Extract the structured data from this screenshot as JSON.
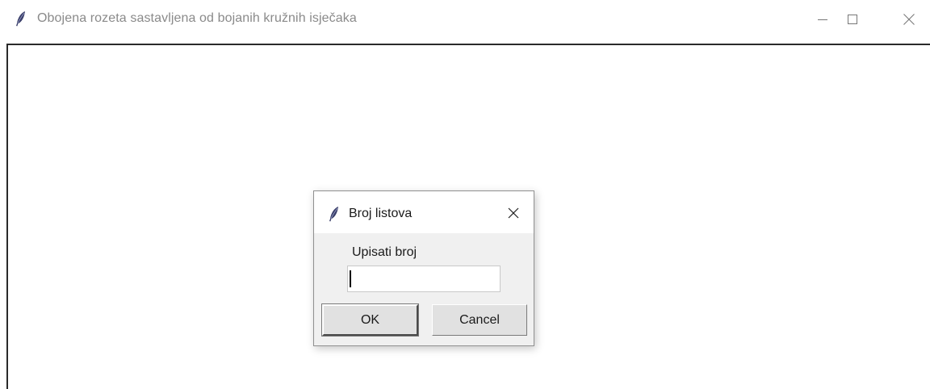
{
  "window": {
    "title": "Obojena rozeta sastavljena od bojanih kružnih isječaka",
    "icon": "feather-icon",
    "controls": [
      "minimize-icon",
      "maximize-icon",
      "close-icon"
    ]
  },
  "dialog": {
    "title": "Broj listova",
    "icon": "feather-icon",
    "prompt": "Upisati broj",
    "entry_value": "",
    "ok_label": "OK",
    "cancel_label": "Cancel"
  }
}
